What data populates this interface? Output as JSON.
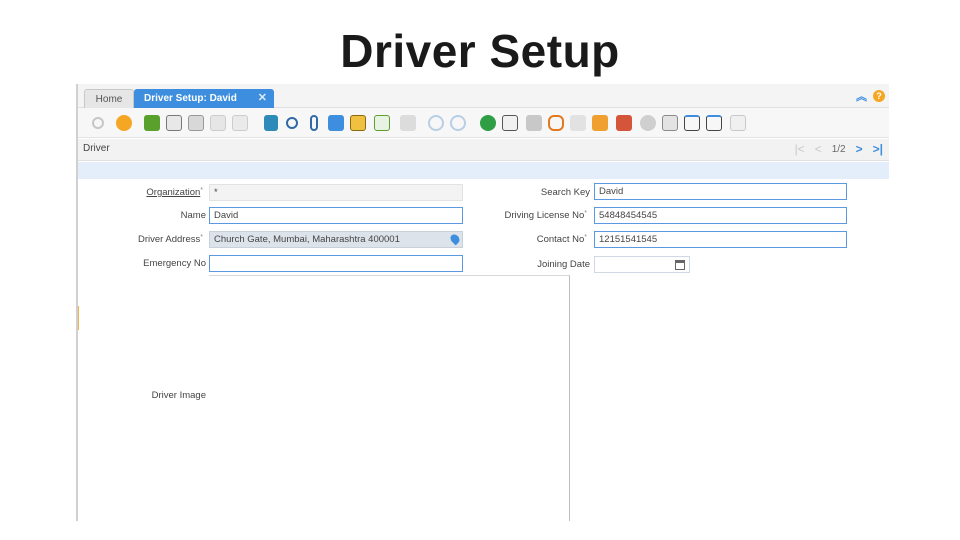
{
  "slide": {
    "title": "Driver Setup"
  },
  "tabs": {
    "home": "Home",
    "driver": "Driver Setup: David David",
    "close": "✕"
  },
  "top_icons": {
    "collapse": "︽",
    "help": "?"
  },
  "toolbar": {
    "icons": [
      "undo-icon",
      "help-icon",
      "new-record-icon",
      "copy-record-icon",
      "delete-icon",
      "save-icon",
      "save-new-icon",
      "refresh-icon",
      "find-icon",
      "attachment-icon",
      "chat-icon",
      "product-info-icon",
      "grid-toggle-icon",
      "settings-icon",
      "parent-record-icon",
      "detail-record-icon",
      "report-icon",
      "print-preview-icon",
      "print-icon",
      "link-icon",
      "request-icon",
      "workflow-icon",
      "archive-icon",
      "process-icon",
      "customize-icon",
      "export-icon",
      "import-icon",
      "copy-icon"
    ]
  },
  "breadcrumb": {
    "label": "Driver"
  },
  "record_nav": {
    "first": "|<",
    "prev": "<",
    "position": "1/2",
    "next": ">",
    "last": ">|"
  },
  "form": {
    "organization": {
      "label": "Organization",
      "value": "*"
    },
    "name": {
      "label": "Name",
      "value": "David"
    },
    "driver_address": {
      "label": "Driver Address",
      "value": "Church Gate, Mumbai, Maharashtra 400001"
    },
    "emergency_no": {
      "label": "Emergency No",
      "value": ""
    },
    "search_key": {
      "label": "Search Key",
      "value": "David"
    },
    "driving_license_no": {
      "label": "Driving License No",
      "value": "54848454545"
    },
    "contact_no": {
      "label": "Contact No",
      "value": "12151541545"
    },
    "joining_date": {
      "label": "Joining Date",
      "value": ""
    },
    "driver_image": {
      "label": "Driver Image"
    },
    "required_mark": "*"
  },
  "colors": {
    "accent": "#3d8ede",
    "help": "#f5a623",
    "band": "#e3eefa"
  }
}
